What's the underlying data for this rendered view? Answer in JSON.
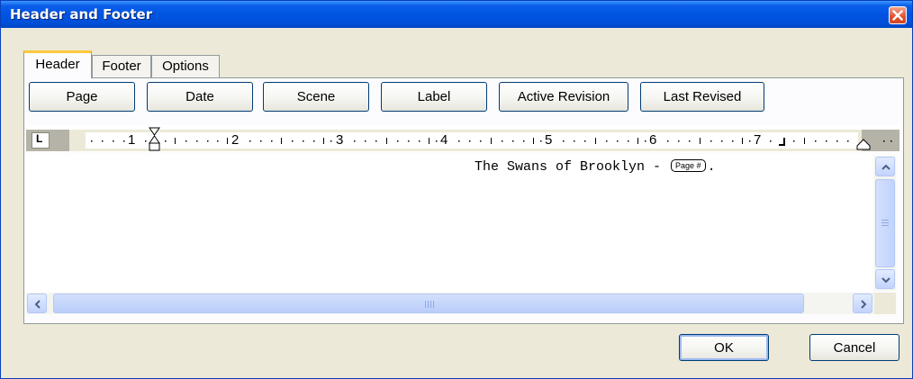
{
  "window": {
    "title": "Header and Footer"
  },
  "tabs": [
    {
      "label": "Header",
      "active": true
    },
    {
      "label": "Footer",
      "active": false
    },
    {
      "label": "Options",
      "active": false
    }
  ],
  "insert_buttons": {
    "page": "Page",
    "date": "Date",
    "scene": "Scene",
    "label": "Label",
    "active_revision": "Active Revision",
    "last_revised": "Last Revised"
  },
  "ruler": {
    "tab_type_marker": "L",
    "numbers": [
      "1",
      "2",
      "3",
      "4",
      "5",
      "6",
      "7"
    ]
  },
  "editor": {
    "header_text": "The Swans of Brooklyn - ",
    "page_field_label": "Page #",
    "trailing_text": "."
  },
  "footer_buttons": {
    "ok": "OK",
    "cancel": "Cancel"
  },
  "colors": {
    "titlebar": "#0054e3",
    "dialog_bg": "#ece9d8",
    "active_tab_accent": "#ffc83c",
    "scrollbar": "#c2d3fc"
  }
}
